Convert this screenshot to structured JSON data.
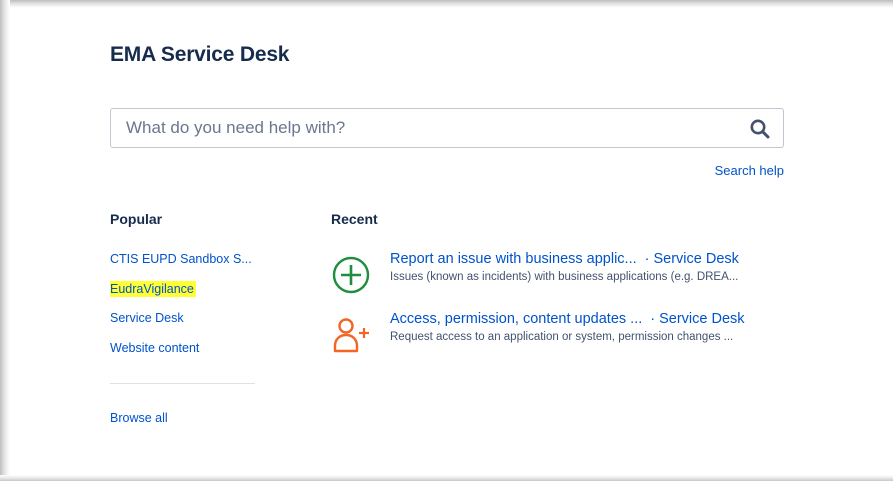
{
  "header": {
    "title": "EMA Service Desk"
  },
  "search": {
    "placeholder": "What do you need help with?",
    "value": "",
    "help_link": "Search help"
  },
  "popular": {
    "heading": "Popular",
    "items": [
      {
        "label": "CTIS EUPD Sandbox S...",
        "highlighted": false
      },
      {
        "label": "EudraVigilance",
        "highlighted": true
      },
      {
        "label": "Service Desk",
        "highlighted": false
      },
      {
        "label": "Website content",
        "highlighted": false
      }
    ],
    "browse_all": "Browse all"
  },
  "recent": {
    "heading": "Recent",
    "items": [
      {
        "icon": "plus-circle-icon",
        "icon_color": "#1e8e3e",
        "title": "Report an issue with business applic...",
        "separator": "·",
        "project": "Service Desk",
        "description": "Issues (known as incidents) with business applications (e.g. DREA..."
      },
      {
        "icon": "add-user-icon",
        "icon_color": "#f26522",
        "title": "Access, permission, content updates ...",
        "separator": "·",
        "project": "Service Desk",
        "description": "Request access to an application or system, permission changes ..."
      }
    ]
  },
  "colors": {
    "link": "#0052cc",
    "heading": "#172b4d",
    "highlight": "#ffff33"
  }
}
